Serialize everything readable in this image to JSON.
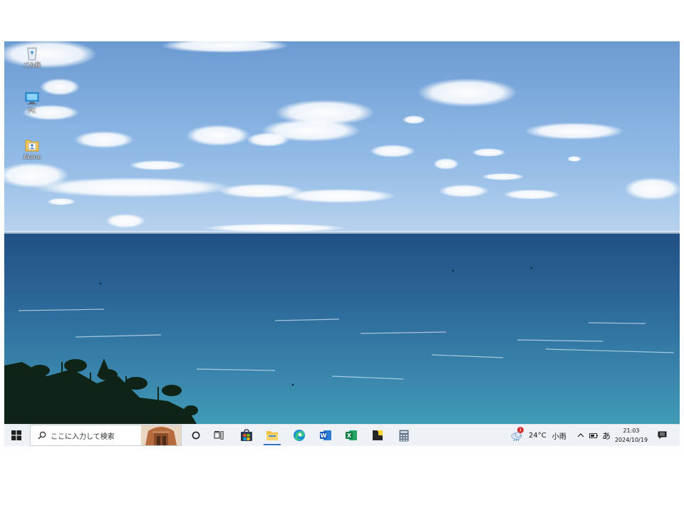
{
  "desktop": {
    "icons": [
      {
        "label": "ごみ箱",
        "icon": "recycle-bin-icon"
      },
      {
        "label": "PC",
        "icon": "computer-icon"
      },
      {
        "label": "Akane",
        "icon": "user-folder-icon"
      }
    ]
  },
  "taskbar": {
    "start_icon": "windows-logo-icon",
    "search_placeholder": "ここに入力して検索",
    "cortana_icon": "cortana-circle-icon",
    "task_view_icon": "task-view-icon",
    "pinned_apps": [
      {
        "name": "Microsoft Store",
        "icon": "store-icon",
        "active": false
      },
      {
        "name": "File Explorer",
        "icon": "folder-icon",
        "active": true
      },
      {
        "name": "Microsoft Edge",
        "icon": "edge-icon",
        "active": false
      },
      {
        "name": "Word",
        "icon": "word-icon",
        "active": false
      },
      {
        "name": "Excel",
        "icon": "excel-icon",
        "active": false
      },
      {
        "name": "Sticky Notes",
        "icon": "sticky-notes-icon",
        "active": false
      },
      {
        "name": "Calculator",
        "icon": "calculator-icon",
        "active": false
      }
    ],
    "weather": {
      "badge": "1",
      "temperature": "24°C",
      "condition": "小雨"
    },
    "tray": {
      "chevron_icon": "chevron-up-icon",
      "battery_icon": "battery-icon",
      "ime": "あ",
      "time": "21:03",
      "date": "2024/10/19",
      "notification_icon": "notification-icon"
    }
  },
  "colors": {
    "taskbar_bg": "#eef1f6",
    "accent": "#3a78c9",
    "sky_top": "#6e9fd6",
    "sea": "#1d5d93"
  }
}
